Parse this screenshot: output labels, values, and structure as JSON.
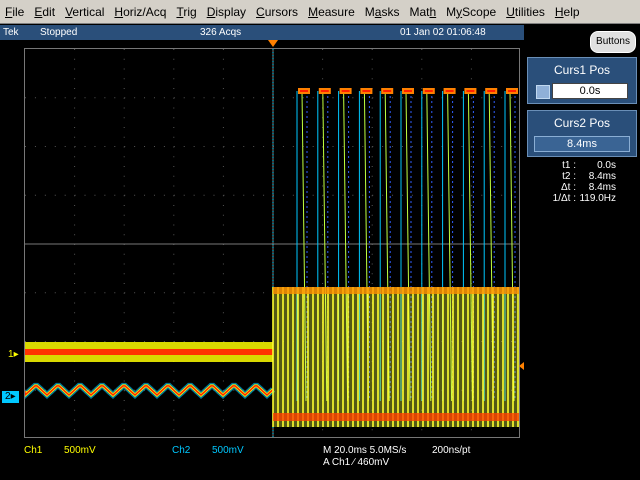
{
  "menu": {
    "items": [
      {
        "label": "File",
        "accel": "F",
        "rest": "ile"
      },
      {
        "label": "Edit",
        "accel": "E",
        "rest": "dit"
      },
      {
        "label": "Vertical",
        "accel": "V",
        "rest": "ertical"
      },
      {
        "label": "Horiz/Acq",
        "accel": "H",
        "rest": "oriz/Acq"
      },
      {
        "label": "Trig",
        "accel": "T",
        "rest": "rig"
      },
      {
        "label": "Display",
        "accel": "D",
        "rest": "isplay"
      },
      {
        "label": "Cursors",
        "accel": "C",
        "rest": "ursors"
      },
      {
        "label": "Measure",
        "accel": "M",
        "rest": "easure"
      },
      {
        "label": "Masks",
        "accel": "a",
        "pre": "M",
        "rest": "sks"
      },
      {
        "label": "Math",
        "accel": "h",
        "pre": "Mat",
        "rest": ""
      },
      {
        "label": "MyScope",
        "accel": "y",
        "pre": "M",
        "rest": "Scope"
      },
      {
        "label": "Utilities",
        "accel": "U",
        "rest": "tilities"
      },
      {
        "label": "Help",
        "accel": "H",
        "rest": "elp"
      }
    ]
  },
  "status": {
    "brand": "Tek",
    "state": "Stopped",
    "acqs": "326 Acqs",
    "datetime": "01 Jan 02 01:06:48"
  },
  "buttons_label": "Buttons",
  "curs1": {
    "title": "Curs1 Pos",
    "value": "0.0s"
  },
  "curs2": {
    "title": "Curs2 Pos",
    "value": "8.4ms"
  },
  "readouts": [
    {
      "label": "t1 :",
      "value": "0.0s"
    },
    {
      "label": "t2 :",
      "value": "8.4ms"
    },
    {
      "label": "Δt :",
      "value": "8.4ms"
    },
    {
      "label": "1/Δt :",
      "value": "119.0Hz"
    }
  ],
  "channels": {
    "ch1_marker": "1",
    "ch2_marker": "2",
    "ch1_label": "Ch1",
    "ch1_scale": "500mV",
    "ch2_label": "Ch2",
    "ch2_scale": "500mV"
  },
  "horizontal": {
    "timebase": "M 20.0ms 5.0MS/s",
    "resolution": "200ns/pt",
    "trigger": "A  Ch1  ∕  460mV"
  },
  "colors": {
    "ch1": "#ffff00",
    "ch2": "#00c8ff",
    "trigger": "#ff8000",
    "status_bg": "#2a4f7a",
    "menu_bg": "#d4d0c8"
  },
  "icons": {
    "keypad": "keypad-icon",
    "trigger_position": "trigger-position-icon",
    "trigger_level": "trigger-level-icon"
  }
}
